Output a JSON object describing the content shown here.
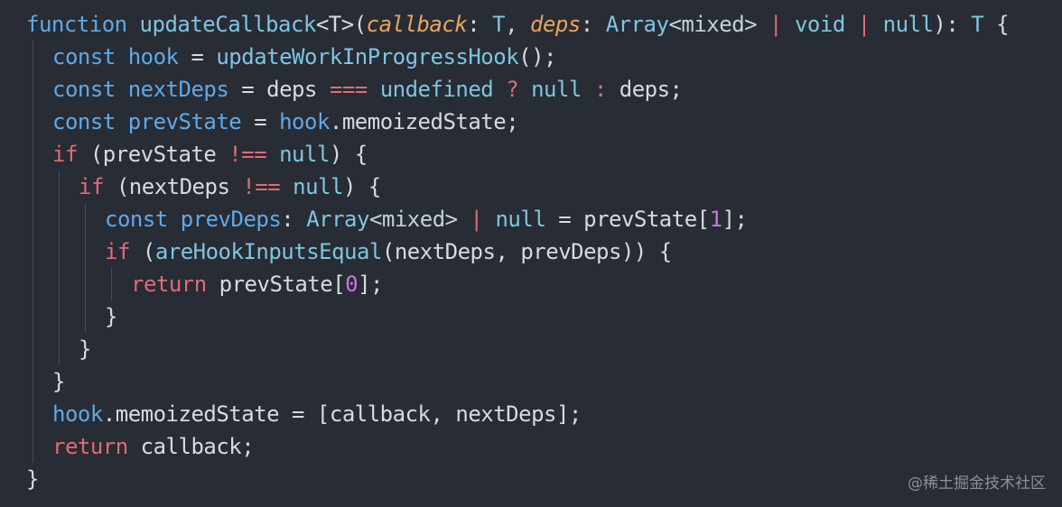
{
  "code_lines": [
    {
      "indent": 0,
      "tokens": [
        {
          "text": "function ",
          "kind": "kw"
        },
        {
          "text": "updateCallback",
          "kind": "fn"
        },
        {
          "text": "<T>(",
          "kind": "pun"
        },
        {
          "text": "callback",
          "kind": "par"
        },
        {
          "text": ": ",
          "kind": "pun"
        },
        {
          "text": "T",
          "kind": "type"
        },
        {
          "text": ", ",
          "kind": "pun"
        },
        {
          "text": "deps",
          "kind": "par"
        },
        {
          "text": ": ",
          "kind": "pun"
        },
        {
          "text": "Array",
          "kind": "type"
        },
        {
          "text": "<mixed>",
          "kind": "gen"
        },
        {
          "text": " | ",
          "kind": "op"
        },
        {
          "text": "void",
          "kind": "type"
        },
        {
          "text": " | ",
          "kind": "op"
        },
        {
          "text": "null",
          "kind": "type"
        },
        {
          "text": "): ",
          "kind": "pun"
        },
        {
          "text": "T",
          "kind": "type"
        },
        {
          "text": " {",
          "kind": "pun"
        }
      ]
    },
    {
      "indent": 1,
      "tokens": [
        {
          "text": "const ",
          "kind": "def"
        },
        {
          "text": "hook",
          "kind": "var"
        },
        {
          "text": " = ",
          "kind": "pun"
        },
        {
          "text": "updateWorkInProgressHook",
          "kind": "fn"
        },
        {
          "text": "();",
          "kind": "pun"
        }
      ]
    },
    {
      "indent": 1,
      "tokens": [
        {
          "text": "const ",
          "kind": "def"
        },
        {
          "text": "nextDeps",
          "kind": "var"
        },
        {
          "text": " = deps ",
          "kind": "pun"
        },
        {
          "text": "===",
          "kind": "op"
        },
        {
          "text": " ",
          "kind": "pun"
        },
        {
          "text": "undefined",
          "kind": "lit"
        },
        {
          "text": " ",
          "kind": "pun"
        },
        {
          "text": "?",
          "kind": "op"
        },
        {
          "text": " ",
          "kind": "pun"
        },
        {
          "text": "null",
          "kind": "lit"
        },
        {
          "text": " ",
          "kind": "pun"
        },
        {
          "text": ":",
          "kind": "op"
        },
        {
          "text": " deps;",
          "kind": "pun"
        }
      ]
    },
    {
      "indent": 1,
      "tokens": [
        {
          "text": "const ",
          "kind": "def"
        },
        {
          "text": "prevState",
          "kind": "var"
        },
        {
          "text": " = ",
          "kind": "pun"
        },
        {
          "text": "hook",
          "kind": "var"
        },
        {
          "text": ".memoizedState;",
          "kind": "prop"
        }
      ]
    },
    {
      "indent": 1,
      "tokens": [
        {
          "text": "if",
          "kind": "ctl"
        },
        {
          "text": " (prevState ",
          "kind": "pun"
        },
        {
          "text": "!==",
          "kind": "op"
        },
        {
          "text": " ",
          "kind": "pun"
        },
        {
          "text": "null",
          "kind": "lit"
        },
        {
          "text": ") {",
          "kind": "pun"
        }
      ]
    },
    {
      "indent": 2,
      "tokens": [
        {
          "text": "if",
          "kind": "ctl"
        },
        {
          "text": " (nextDeps ",
          "kind": "pun"
        },
        {
          "text": "!==",
          "kind": "op"
        },
        {
          "text": " ",
          "kind": "pun"
        },
        {
          "text": "null",
          "kind": "lit"
        },
        {
          "text": ") {",
          "kind": "pun"
        }
      ]
    },
    {
      "indent": 3,
      "tokens": [
        {
          "text": "const ",
          "kind": "def"
        },
        {
          "text": "prevDeps",
          "kind": "var"
        },
        {
          "text": ": ",
          "kind": "pun"
        },
        {
          "text": "Array",
          "kind": "type"
        },
        {
          "text": "<mixed>",
          "kind": "gen"
        },
        {
          "text": " | ",
          "kind": "op"
        },
        {
          "text": "null",
          "kind": "lit"
        },
        {
          "text": " = prevState[",
          "kind": "pun"
        },
        {
          "text": "1",
          "kind": "num"
        },
        {
          "text": "];",
          "kind": "pun"
        }
      ]
    },
    {
      "indent": 3,
      "tokens": [
        {
          "text": "if",
          "kind": "ctl"
        },
        {
          "text": " (",
          "kind": "pun"
        },
        {
          "text": "areHookInputsEqual",
          "kind": "fn"
        },
        {
          "text": "(nextDeps, prevDeps)) {",
          "kind": "pun"
        }
      ]
    },
    {
      "indent": 4,
      "tokens": [
        {
          "text": "return",
          "kind": "ret"
        },
        {
          "text": " prevState[",
          "kind": "pun"
        },
        {
          "text": "0",
          "kind": "num"
        },
        {
          "text": "];",
          "kind": "pun"
        }
      ]
    },
    {
      "indent": 3,
      "tokens": [
        {
          "text": "}",
          "kind": "pun"
        }
      ]
    },
    {
      "indent": 2,
      "tokens": [
        {
          "text": "}",
          "kind": "pun"
        }
      ]
    },
    {
      "indent": 1,
      "tokens": [
        {
          "text": "}",
          "kind": "pun"
        }
      ]
    },
    {
      "indent": 1,
      "tokens": [
        {
          "text": "hook",
          "kind": "var"
        },
        {
          "text": ".memoizedState = [callback, nextDeps];",
          "kind": "prop"
        }
      ]
    },
    {
      "indent": 1,
      "tokens": [
        {
          "text": "return",
          "kind": "ret"
        },
        {
          "text": " callback;",
          "kind": "pun"
        }
      ]
    },
    {
      "indent": 0,
      "tokens": [
        {
          "text": "}",
          "kind": "pun"
        }
      ]
    }
  ],
  "watermark": "@稀土掘金技术社区",
  "colors": {
    "background": "#282c34",
    "keyword": "#60a9e8",
    "function": "#7ec5e0",
    "parameter": "#e7a55c",
    "operator": "#e06c75",
    "number": "#c678dd",
    "text": "#d7dae0"
  }
}
